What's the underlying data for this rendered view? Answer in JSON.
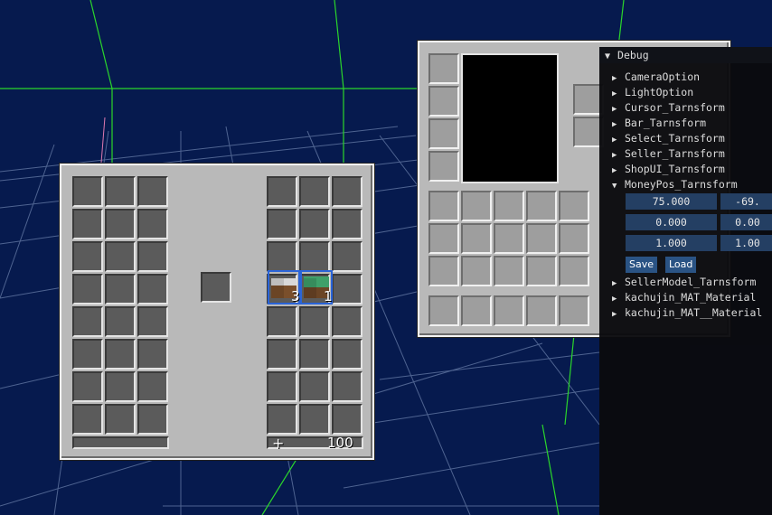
{
  "inventory": {
    "left_slots": 24,
    "right_slots": 24,
    "items": [
      {
        "icon": "snow-dirt-block-icon",
        "count": "3"
      },
      {
        "icon": "grass-block-icon",
        "count": "1"
      }
    ],
    "plus_label": "+",
    "money_label": "100"
  },
  "debug": {
    "title": "Debug",
    "tree": [
      {
        "label": "CameraOption",
        "expanded": false
      },
      {
        "label": "LightOption",
        "expanded": false
      },
      {
        "label": "Cursor_Tarnsform",
        "expanded": false
      },
      {
        "label": "Bar_Tarnsform",
        "expanded": false
      },
      {
        "label": "Select_Tarnsform",
        "expanded": false
      },
      {
        "label": "Seller_Tarnsform",
        "expanded": false
      },
      {
        "label": "ShopUI_Tarnsform",
        "expanded": false
      },
      {
        "label": "MoneyPos_Tarnsform",
        "expanded": true
      }
    ],
    "fields": {
      "pos_x": "75.000",
      "pos_y": "-69.",
      "rot_x": "0.000",
      "rot_y": "0.00",
      "scale_x": "1.000",
      "scale_y": "1.00"
    },
    "save_label": "Save",
    "load_label": "Load",
    "tree_after": [
      {
        "label": "SellerModel_Tarnsform",
        "expanded": false
      },
      {
        "label": "kachujin_MAT_Material",
        "expanded": false
      },
      {
        "label": "kachujin_MAT__Material",
        "expanded": false
      }
    ]
  },
  "colors": {
    "sky": "#061a4e",
    "grid": "#2bd62b",
    "panel": "#b9b9b9",
    "slot": "#5b5b5b",
    "debug_bg": "#0a0a0e",
    "field": "#243f63",
    "button": "#2a5384"
  }
}
